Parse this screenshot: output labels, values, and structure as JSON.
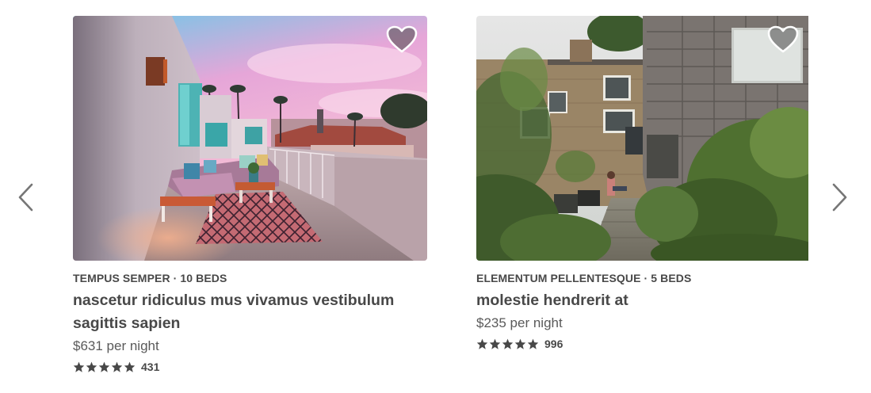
{
  "navigation": {
    "prev_icon": "chevron-left-icon",
    "next_icon": "chevron-right-icon",
    "arrow_color": "#767676"
  },
  "listings": [
    {
      "kicker": "TEMPUS SEMPER · 10 BEDS",
      "title": "nascetur ridiculus mus vivamus vestibulum sagittis sapien",
      "price": "$631 per night",
      "rating_stars": 5,
      "review_count": "431",
      "favorite_icon": "heart-icon",
      "photo": "rooftop-patio-with-sofa-and-palm-trees"
    },
    {
      "kicker": "ELEMENTUM PELLENTESQUE · 5 BEDS",
      "title": "molestie hendrerit at",
      "price": "$235 per night",
      "rating_stars": 5,
      "review_count": "996",
      "favorite_icon": "heart-icon",
      "photo": "garden-courtyard-between-buildings"
    }
  ],
  "colors": {
    "text": "#484848",
    "star": "#484848"
  }
}
